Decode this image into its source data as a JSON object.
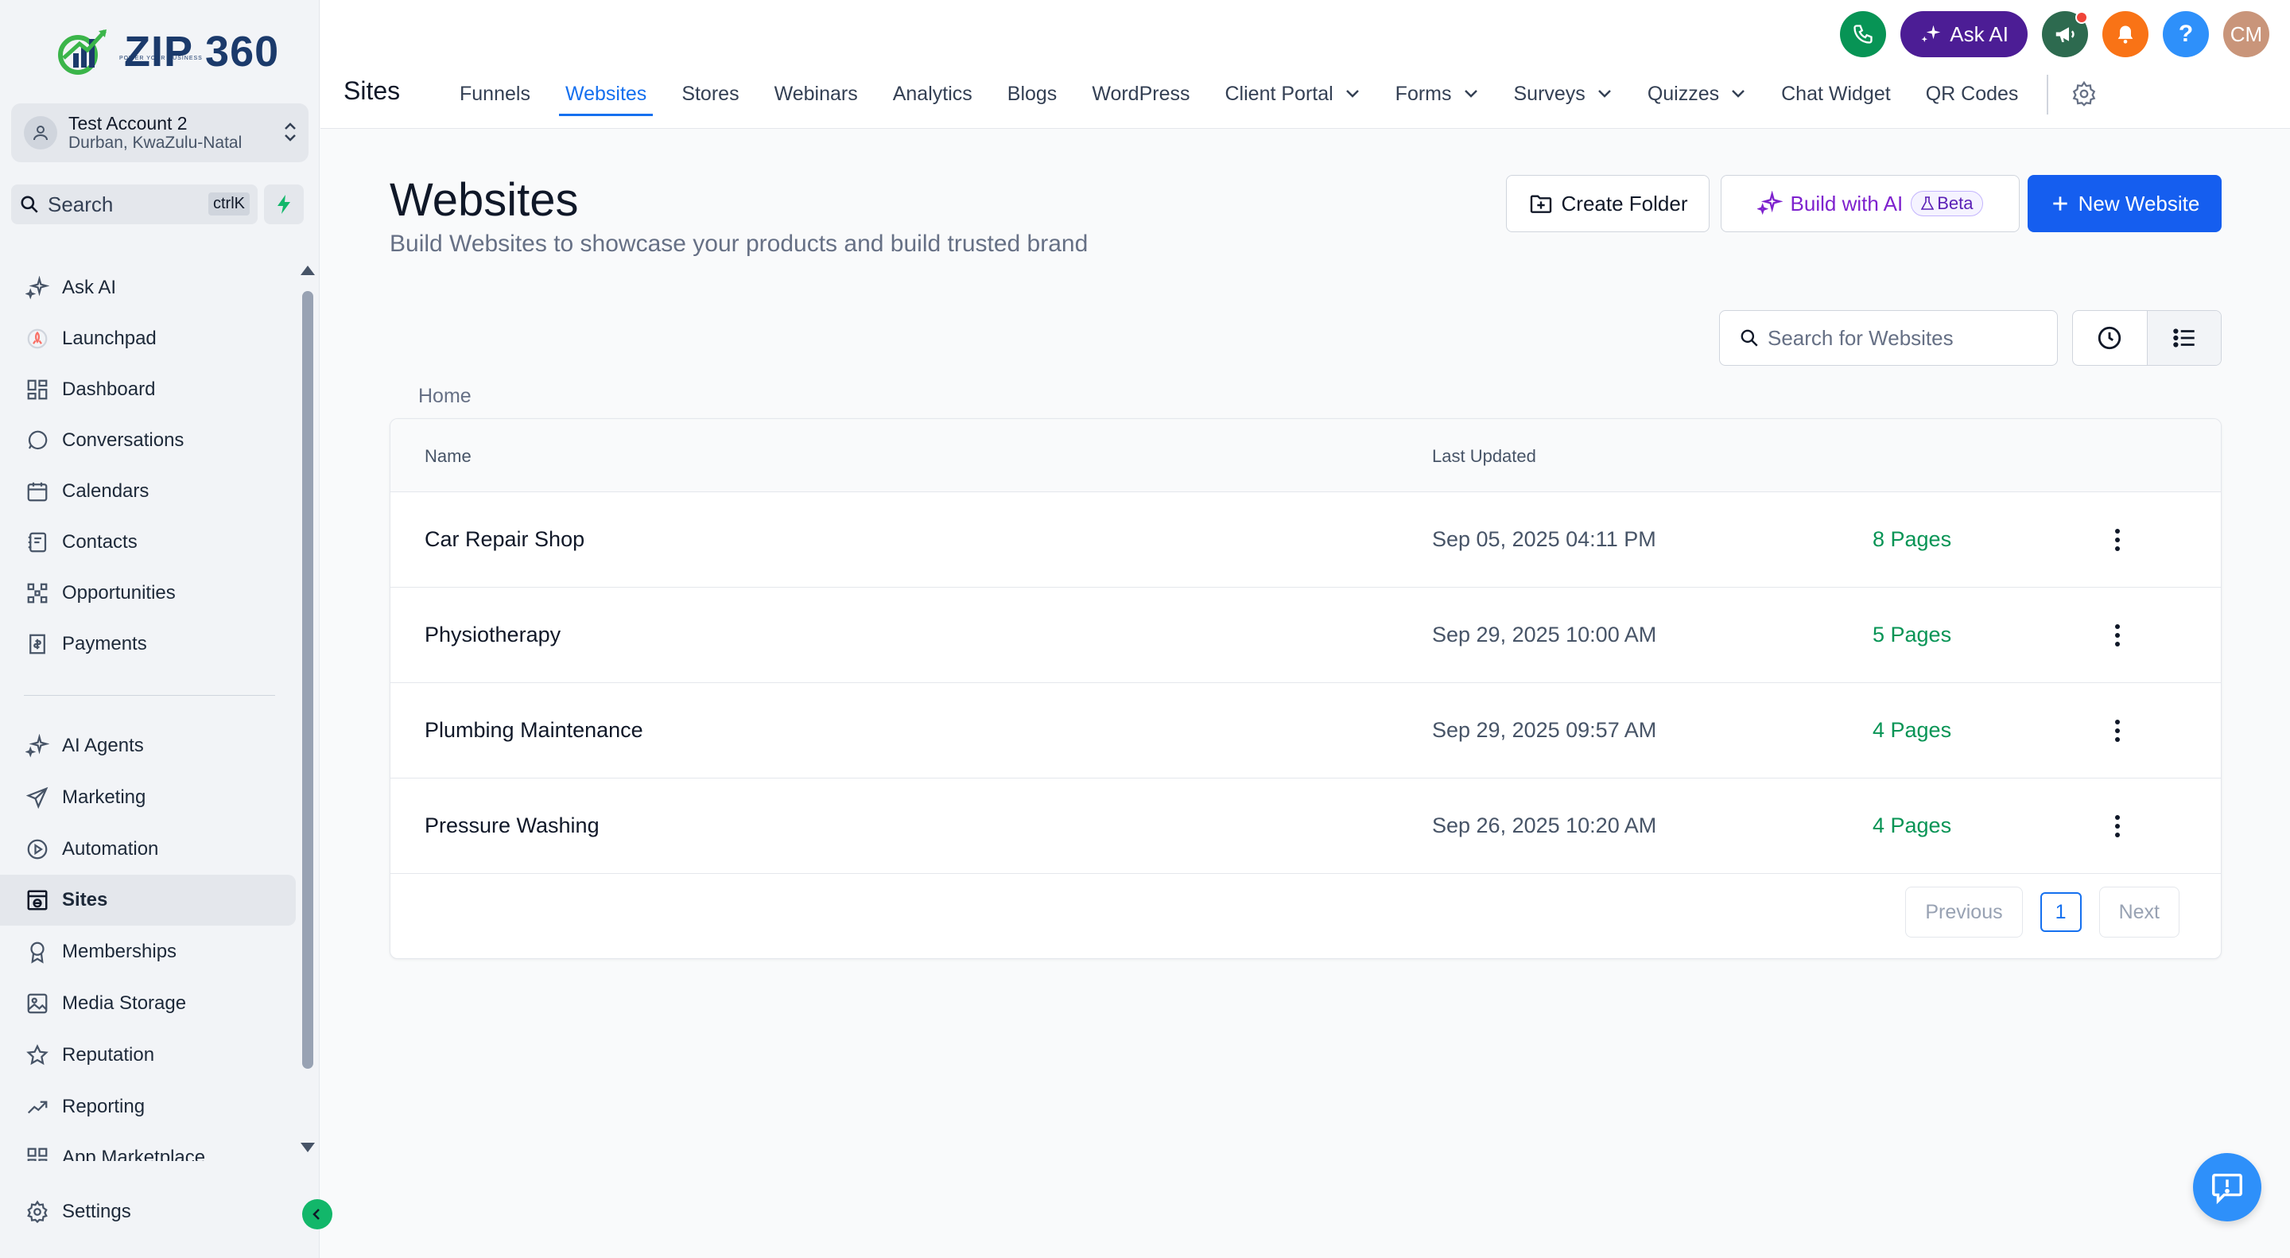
{
  "brand": {
    "name": "ZIP 360",
    "tagline": "POWER YOUR BUSINESS"
  },
  "account": {
    "name": "Test Account 2",
    "location": "Durban, KwaZulu-Natal"
  },
  "search": {
    "label": "Search",
    "shortcut": "ctrlK"
  },
  "sidebar": {
    "items": [
      {
        "label": "Ask AI",
        "icon": "sparkles-icon"
      },
      {
        "label": "Launchpad",
        "icon": "rocket-icon"
      },
      {
        "label": "Dashboard",
        "icon": "grid-icon"
      },
      {
        "label": "Conversations",
        "icon": "chat-bubble-icon"
      },
      {
        "label": "Calendars",
        "icon": "calendar-icon"
      },
      {
        "label": "Contacts",
        "icon": "address-book-icon"
      },
      {
        "label": "Opportunities",
        "icon": "pipeline-icon"
      },
      {
        "label": "Payments",
        "icon": "receipt-icon"
      },
      {
        "label": "AI Agents",
        "icon": "sparkles-icon"
      },
      {
        "label": "Marketing",
        "icon": "send-icon"
      },
      {
        "label": "Automation",
        "icon": "automation-icon"
      },
      {
        "label": "Sites",
        "icon": "globe-window-icon",
        "active": true
      },
      {
        "label": "Memberships",
        "icon": "award-icon"
      },
      {
        "label": "Media Storage",
        "icon": "image-icon"
      },
      {
        "label": "Reputation",
        "icon": "star-icon"
      },
      {
        "label": "Reporting",
        "icon": "trend-icon"
      },
      {
        "label": "App Marketplace",
        "icon": "apps-icon"
      }
    ],
    "settings_label": "Settings"
  },
  "topbar": {
    "ask_ai_label": "Ask AI",
    "avatar_initials": "CM",
    "section": "Sites",
    "tabs": [
      {
        "label": "Funnels"
      },
      {
        "label": "Websites",
        "active": true
      },
      {
        "label": "Stores"
      },
      {
        "label": "Webinars"
      },
      {
        "label": "Analytics"
      },
      {
        "label": "Blogs"
      },
      {
        "label": "WordPress"
      },
      {
        "label": "Client Portal",
        "dropdown": true
      },
      {
        "label": "Forms",
        "dropdown": true
      },
      {
        "label": "Surveys",
        "dropdown": true
      },
      {
        "label": "Quizzes",
        "dropdown": true
      },
      {
        "label": "Chat Widget"
      },
      {
        "label": "QR Codes"
      }
    ]
  },
  "main": {
    "title": "Websites",
    "subtitle": "Build Websites to showcase your products and build trusted brand",
    "create_folder_label": "Create Folder",
    "build_ai_label": "Build with AI",
    "beta_label": "Beta",
    "new_website_label": "New Website",
    "search_placeholder": "Search for Websites",
    "breadcrumb": "Home",
    "columns": {
      "name": "Name",
      "updated": "Last Updated"
    },
    "rows": [
      {
        "name": "Car Repair Shop",
        "updated": "Sep 05, 2025 04:11 PM",
        "pages": "8 Pages"
      },
      {
        "name": "Physiotherapy",
        "updated": "Sep 29, 2025 10:00 AM",
        "pages": "5 Pages"
      },
      {
        "name": "Plumbing Maintenance",
        "updated": "Sep 29, 2025 09:57 AM",
        "pages": "4 Pages"
      },
      {
        "name": "Pressure Washing",
        "updated": "Sep 26, 2025 10:20 AM",
        "pages": "4 Pages"
      }
    ],
    "pagination": {
      "previous": "Previous",
      "current": "1",
      "next": "Next"
    }
  },
  "colors": {
    "primary": "#155eef",
    "active_tab": "#1570ef",
    "pages_green": "#079455",
    "ask_ai_purple": "#4c1d95",
    "phone_green": "#12b76a",
    "bell_orange": "#f97316",
    "help_blue": "#2e90fa"
  }
}
